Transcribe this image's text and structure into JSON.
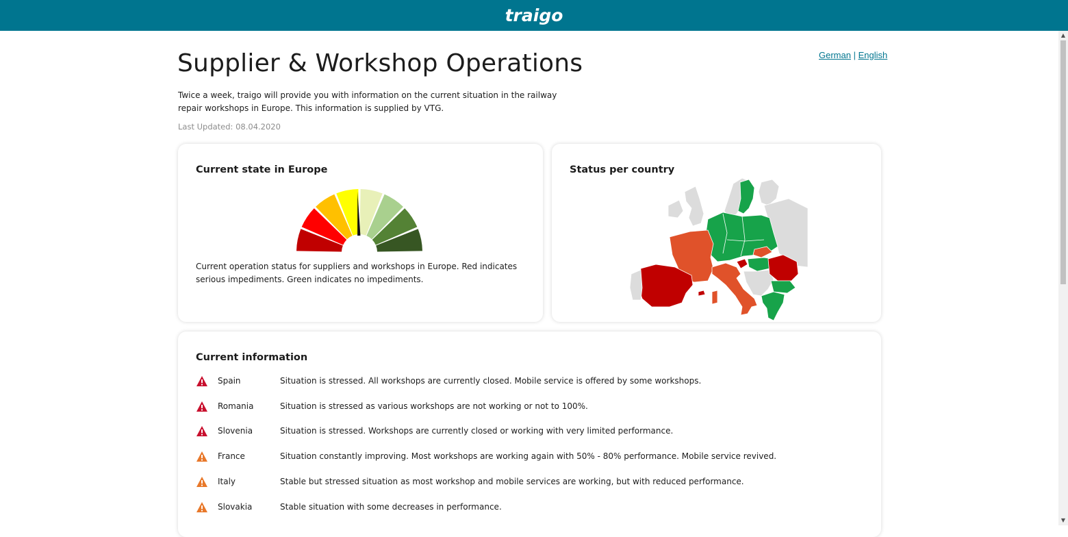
{
  "brand": {
    "logo_text": "traigo",
    "bar_color": "#00758f"
  },
  "header": {
    "title": "Supplier & Workshop Operations",
    "languages": [
      "German",
      "English"
    ],
    "separator": "|",
    "intro": "Twice a week, traigo will provide you with information on the current situation in the railway repair workshops in Europe. This information is supplied by VTG.",
    "last_updated": "Last Updated: 08.04.2020"
  },
  "europe_card": {
    "title": "Current state in Europe",
    "description": "Current operation status for suppliers and workshops in Europe. Red indicates serious impediments. Green indicates no impediments.",
    "gauge_colors": [
      "#c00000",
      "#ff0000",
      "#ffc000",
      "#ffff00",
      "#e8f0b8",
      "#a9d08e",
      "#548235",
      "#375623"
    ],
    "needle_fraction": 0.49
  },
  "country_card": {
    "title": "Status per country"
  },
  "info_card": {
    "title": "Current information",
    "items": [
      {
        "country": "Spain",
        "severity": "high",
        "message": "Situation is stressed. All workshops are currently closed. Mobile service is offered by some workshops."
      },
      {
        "country": "Romania",
        "severity": "high",
        "message": "Situation is stressed as various workshops are not working or not to 100%."
      },
      {
        "country": "Slovenia",
        "severity": "high",
        "message": "Situation is stressed. Workshops are currently closed or working with very limited performance."
      },
      {
        "country": "France",
        "severity": "medium",
        "message": "Situation constantly improving. Most workshops are working again with 50% - 80% performance. Mobile service revived."
      },
      {
        "country": "Italy",
        "severity": "medium",
        "message": "Stable but stressed situation as most workshop and mobile services are working, but with reduced performance."
      },
      {
        "country": "Slovakia",
        "severity": "medium",
        "message": "Stable situation with some decreases in performance."
      }
    ]
  },
  "colors": {
    "red": "#c00000",
    "orange": "#e07020",
    "green": "#17a34a",
    "grey": "#dcdcdc"
  }
}
